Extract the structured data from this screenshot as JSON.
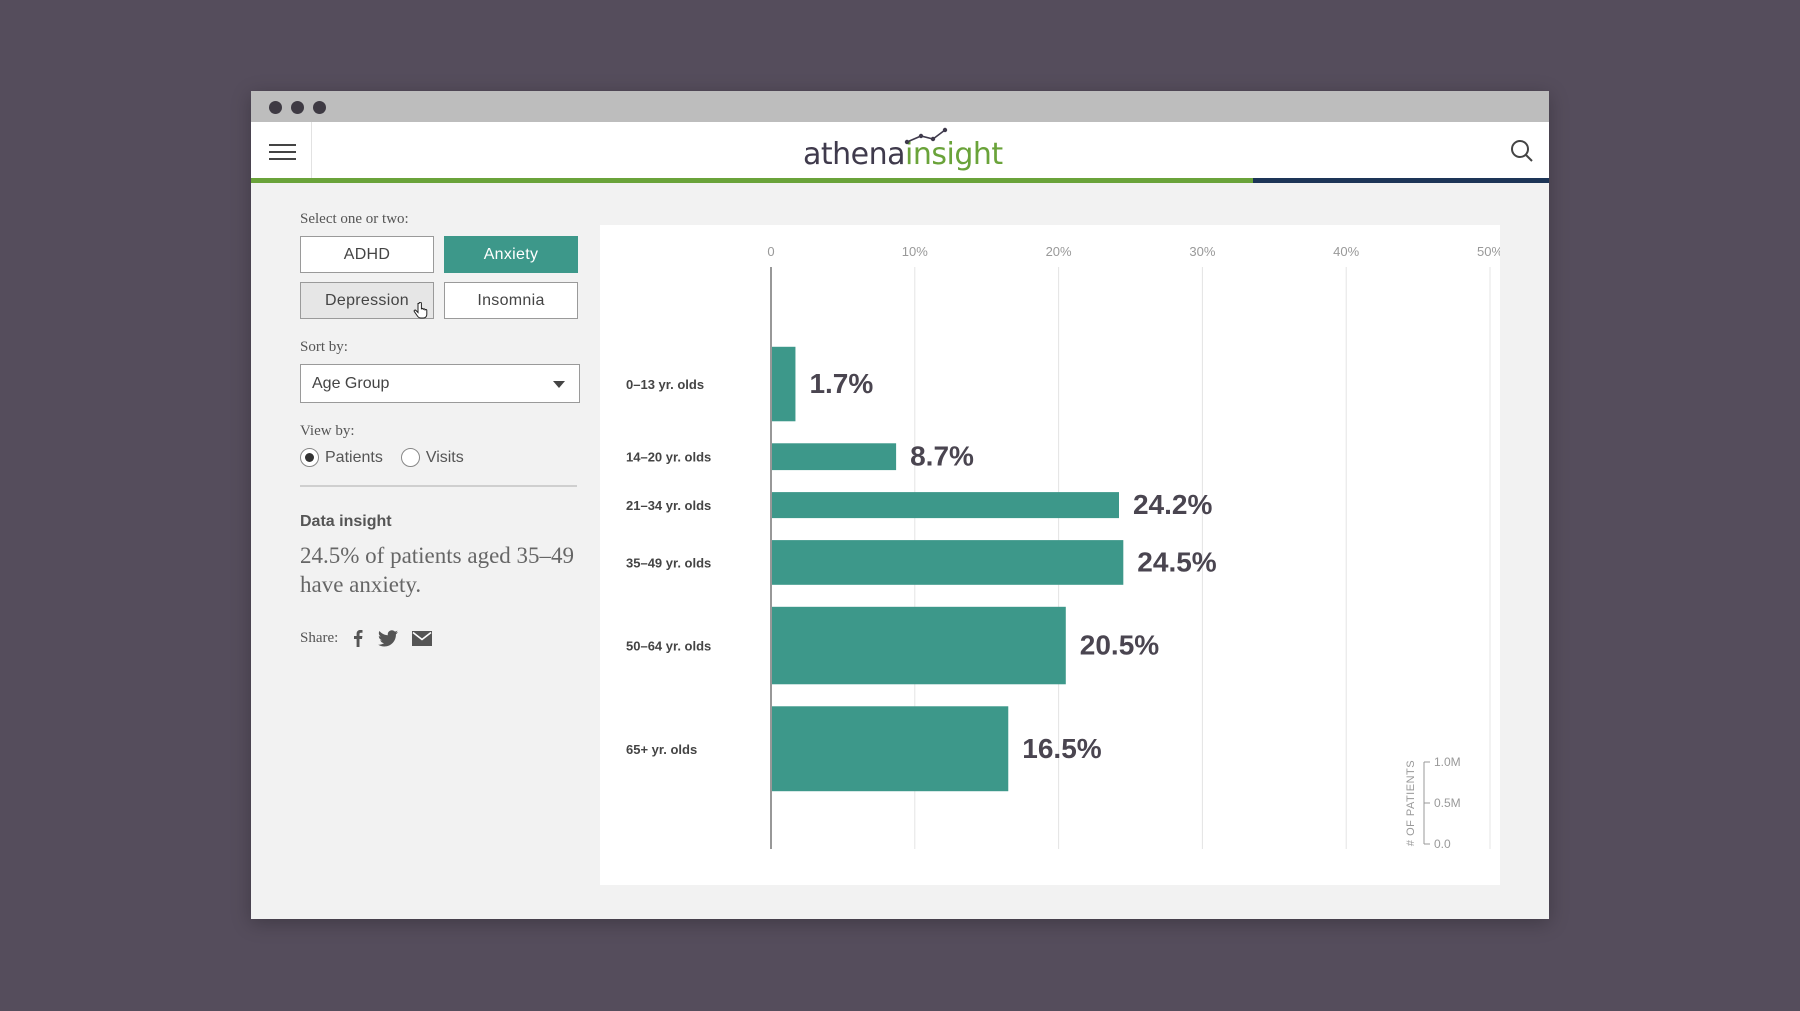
{
  "app": {
    "logo_part1": "athena",
    "logo_part2": "insight",
    "progress_fraction": 0.772
  },
  "sidebar": {
    "select_label": "Select one or two:",
    "conditions": [
      {
        "label": "ADHD",
        "state": "normal"
      },
      {
        "label": "Anxiety",
        "state": "selected"
      },
      {
        "label": "Depression",
        "state": "hover"
      },
      {
        "label": "Insomnia",
        "state": "normal"
      }
    ],
    "sort_label": "Sort by:",
    "sort_value": "Age Group",
    "view_label": "View by:",
    "view_options": [
      {
        "label": "Patients",
        "selected": true
      },
      {
        "label": "Visits",
        "selected": false
      }
    ],
    "insight_title": "Data insight",
    "insight_text": "24.5% of patients aged 35–49 have anxiety.",
    "share_label": "Share:",
    "share_icons": [
      "facebook-icon",
      "twitter-icon",
      "email-icon"
    ]
  },
  "colors": {
    "accent": "#3d988a",
    "brand_green": "#6aa33a",
    "brand_navy": "#1d3557",
    "background": "#554d5c"
  },
  "chart_data": {
    "type": "bar",
    "orientation": "horizontal",
    "categories": [
      "0–13 yr. olds",
      "14–20 yr. olds",
      "21–34 yr. olds",
      "35–49 yr. olds",
      "50–64 yr. olds",
      "65+ yr. olds"
    ],
    "values": [
      1.7,
      8.7,
      24.2,
      24.5,
      20.5,
      16.5
    ],
    "value_labels": [
      "1.7%",
      "8.7%",
      "24.2%",
      "24.5%",
      "20.5%",
      "16.5%"
    ],
    "bar_thickness_patients_millions": [
      0.5,
      0.18,
      0.17,
      0.3,
      0.52,
      0.57
    ],
    "xlim": [
      0,
      50
    ],
    "x_ticks": [
      "0",
      "10%",
      "20%",
      "30%",
      "40%",
      "50%"
    ],
    "x_tick_values": [
      0,
      10,
      20,
      30,
      40,
      50
    ],
    "grid": true,
    "size_legend": {
      "title": "# OF PATIENTS",
      "ticks": [
        "1.0M",
        "0.5M",
        "0.0"
      ]
    }
  }
}
